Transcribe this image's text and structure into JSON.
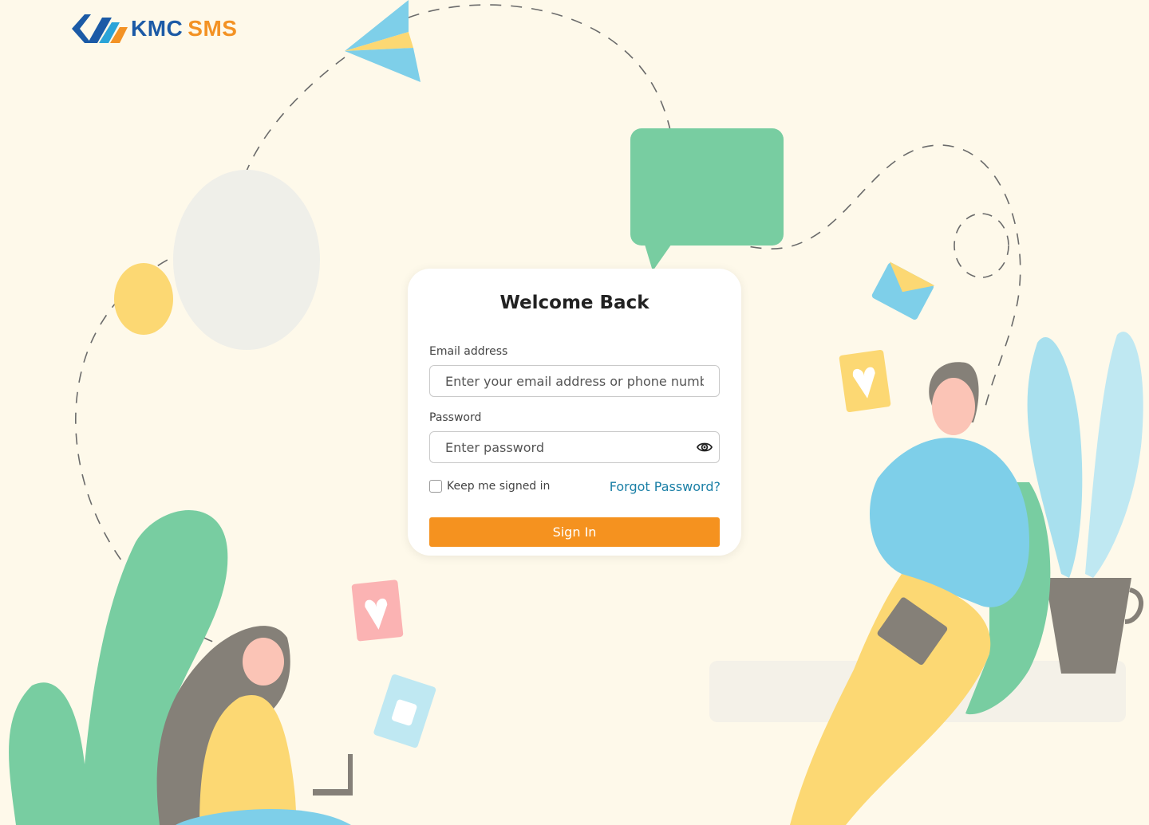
{
  "brand": {
    "name_part1": "KMC",
    "name_part2": "SMS",
    "primary_color": "#1b5aa6",
    "accent_color": "#f39224"
  },
  "login": {
    "title": "Welcome Back",
    "email_label": "Email address",
    "email_placeholder": "Enter your email address or phone number",
    "password_label": "Password",
    "password_placeholder": "Enter password",
    "keep_signed_in": "Keep me signed in",
    "forgot_password": "Forgot Password?",
    "sign_in": "Sign In",
    "button_color": "#f5921f",
    "link_color": "#1a7fa6"
  },
  "background": {
    "color": "#fef9ea",
    "illustration": "people-messaging-illustration"
  }
}
